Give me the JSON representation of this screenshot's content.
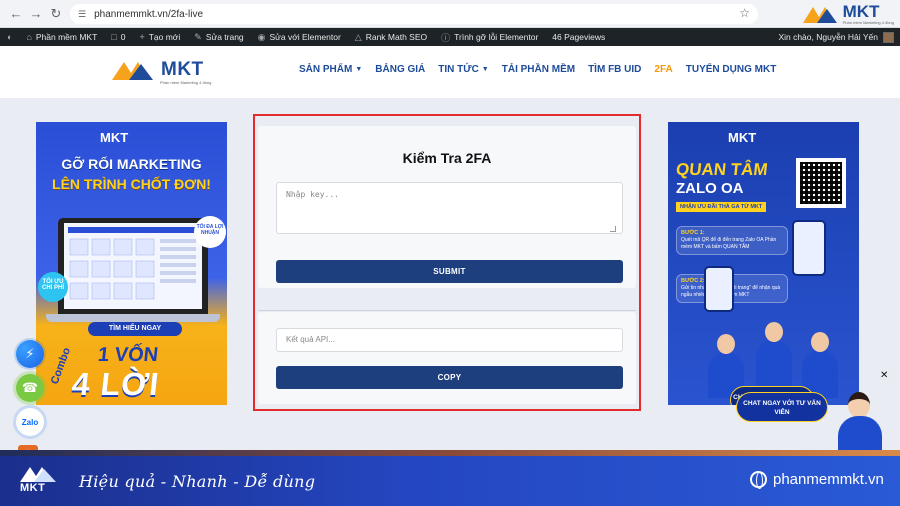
{
  "browser": {
    "url": "phanmemmkt.vn/2fa-live"
  },
  "brand": {
    "name": "MKT",
    "tagline": "Phần mềm Marketing 4 đồng"
  },
  "wp_bar": {
    "items": [
      {
        "icon": "wordpress-icon",
        "label": ""
      },
      {
        "icon": "home-icon",
        "label": "Phần mềm MKT"
      },
      {
        "icon": "comment-icon",
        "label": "0"
      },
      {
        "icon": "plus-icon",
        "label": "Tạo mới"
      },
      {
        "icon": "edit-icon",
        "label": "Sửa trang"
      },
      {
        "icon": "elementor-icon",
        "label": "Sửa với Elementor"
      },
      {
        "icon": "rankmath-icon",
        "label": "Rank Math SEO"
      },
      {
        "icon": "info-icon",
        "label": "Trình gỡ lỗi Elementor"
      },
      {
        "icon": "",
        "label": "46 Pageviews"
      }
    ],
    "greeting": "Xin chào, Nguyễn Hải Yến"
  },
  "nav": {
    "items": [
      {
        "label": "SẢN PHẨM",
        "dropdown": true,
        "active": false
      },
      {
        "label": "BẢNG GIÁ",
        "dropdown": false,
        "active": false
      },
      {
        "label": "TIN TỨC",
        "dropdown": true,
        "active": false
      },
      {
        "label": "TẢI PHẦN MỀM",
        "dropdown": false,
        "active": false
      },
      {
        "label": "TÌM FB UID",
        "dropdown": false,
        "active": false
      },
      {
        "label": "2FA",
        "dropdown": false,
        "active": true
      },
      {
        "label": "TUYỂN DỤNG MKT",
        "dropdown": false,
        "active": false
      }
    ]
  },
  "left_banner": {
    "brand": "MKT",
    "headline_1": "GỠ RỐI MARKETING",
    "headline_2": "LÊN TRÌNH CHỐT ĐƠN!",
    "badge_1": "TỐI ĐA LỢI NHUẬN",
    "badge_2": "TỐI ƯU CHI PHÍ",
    "cta": "TÌM HIỂU NGAY",
    "combo": "Combo",
    "big_1": "1 VỐN",
    "big_2": "4 LỜI"
  },
  "right_banner": {
    "brand": "MKT",
    "headline_1": "QUAN TÂM",
    "headline_2": "ZALO OA",
    "tag": "NHẬN ƯU ĐÃI THẢ GA TỪ MKT",
    "step_1_title": "BƯỚC 1:",
    "step_1_text": "Quét mã QR để đi đến trang Zalo OA Phần mềm MKT và bấm QUAN TÂM",
    "step_2_title": "BƯỚC 2:",
    "step_2_text": "Gửi tin nhắn \"đã theo dõi trang\" để nhận quà ngẫu nhiên từ Phần mềm MKT",
    "chat_cta": "CHAT NGAY VỚI TƯ VẤN VIÊN"
  },
  "form": {
    "title": "Kiểm Tra 2FA",
    "key_placeholder": "Nhập key...",
    "submit_label": "SUBMIT",
    "result_placeholder": "Kết quả API...",
    "copy_label": "COPY"
  },
  "floating": {
    "zalo_label": "Zalo",
    "agent_chat": "CHAT NGAY VỚI TƯ VẤN VIÊN"
  },
  "footer": {
    "brand": "MKT",
    "slogan": "Hiệu quả - Nhanh  - Dễ dùng",
    "site": "phanmemmkt.vn"
  },
  "colors": {
    "primary": "#1e3f7e",
    "accent": "#f39c12",
    "highlight_border": "#e32b2b"
  }
}
